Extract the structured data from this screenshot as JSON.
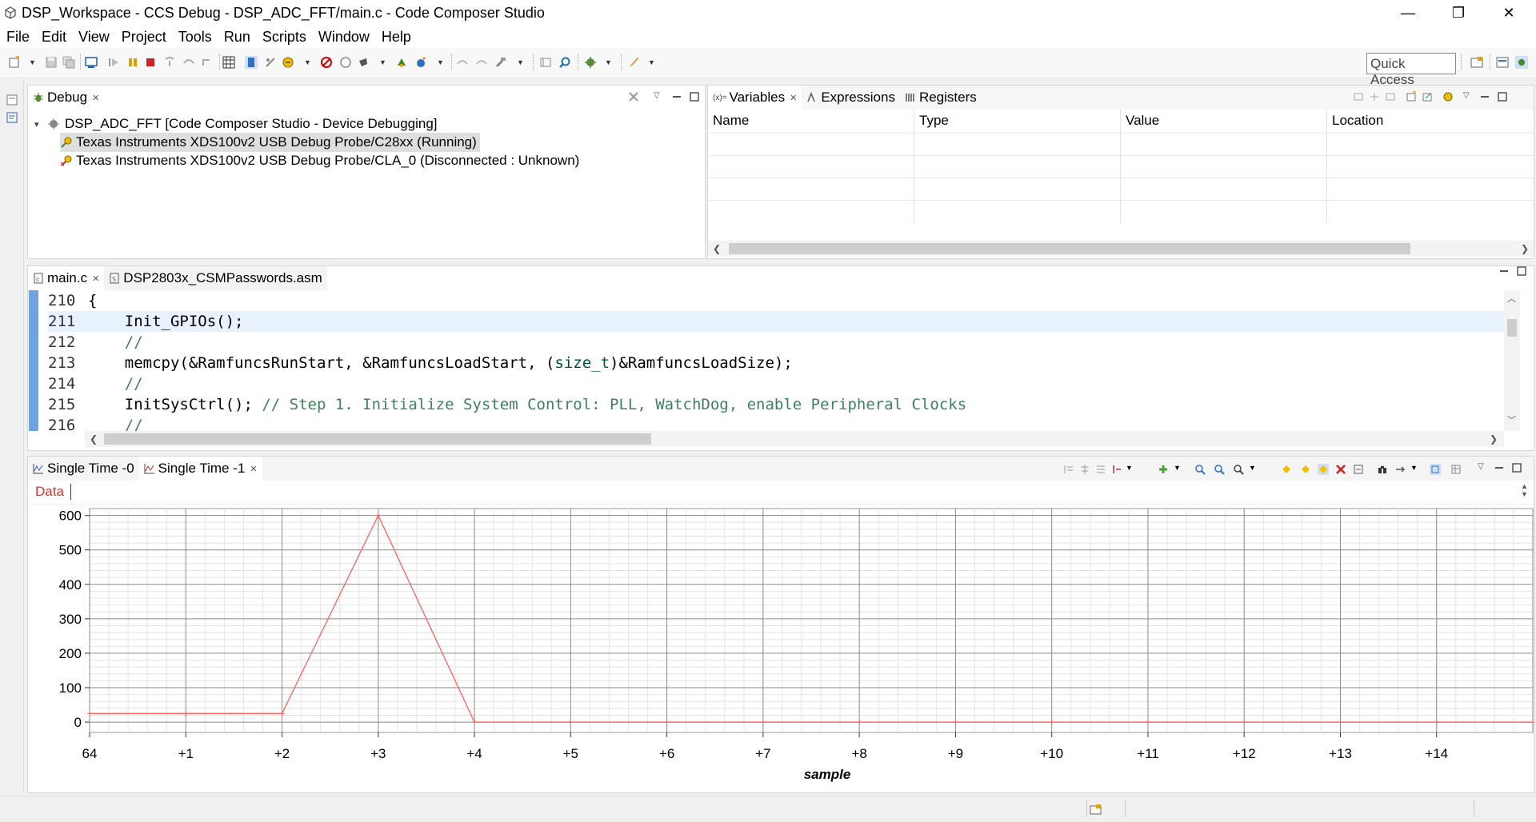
{
  "window": {
    "title": "DSP_Workspace - CCS Debug - DSP_ADC_FFT/main.c - Code Composer Studio",
    "minimize": "—",
    "restore": "❐",
    "close": "✕"
  },
  "menu": [
    "File",
    "Edit",
    "View",
    "Project",
    "Tools",
    "Run",
    "Scripts",
    "Window",
    "Help"
  ],
  "quick_access": "Quick Access",
  "debug_view": {
    "tab_label": "Debug",
    "session": "DSP_ADC_FFT [Code Composer Studio - Device Debugging]",
    "targets": [
      "Texas Instruments XDS100v2 USB Debug Probe/C28xx (Running)",
      "Texas Instruments XDS100v2 USB Debug Probe/CLA_0 (Disconnected : Unknown)"
    ]
  },
  "variables_view": {
    "tabs": [
      "Variables",
      "Expressions",
      "Registers"
    ],
    "tab_prefix": "(x)=",
    "columns": [
      "Name",
      "Type",
      "Value",
      "Location"
    ]
  },
  "editor": {
    "tabs": [
      "main.c",
      "DSP2803x_CSMPasswords.asm"
    ],
    "lines": [
      {
        "num": "210",
        "code": "{",
        "comment": ""
      },
      {
        "num": "211",
        "code": "    Init_GPIOs();",
        "comment": ""
      },
      {
        "num": "212",
        "code": "    //",
        "comment": ""
      },
      {
        "num": "213",
        "code_pre": "    memcpy(&RamfuncsRunStart, &RamfuncsLoadStart, (",
        "code_kw": "size_t",
        "code_post": ")&RamfuncsLoadSize);"
      },
      {
        "num": "214",
        "code": "    //",
        "comment": ""
      },
      {
        "num": "215",
        "code": "    InitSysCtrl(); ",
        "comment": "// Step 1. Initialize System Control: PLL, WatchDog, enable Peripheral Clocks"
      },
      {
        "num": "216",
        "code": "    //",
        "comment": ""
      }
    ]
  },
  "graph_view": {
    "tabs": [
      "Single Time -0",
      "Single Time -1"
    ],
    "legend_label": "Data",
    "colors": {
      "series": "#ff6060",
      "legend": "#e03030"
    }
  },
  "chart_data": {
    "type": "line",
    "x": [
      0,
      1,
      2,
      3,
      4,
      5,
      6,
      7,
      8,
      9,
      10,
      11,
      12,
      13,
      14,
      15
    ],
    "tick_labels": [
      "64",
      "+1",
      "+2",
      "+3",
      "+4",
      "+5",
      "+6",
      "+7",
      "+8",
      "+9",
      "+10",
      "+11",
      "+12",
      "+13",
      "+14"
    ],
    "series": [
      {
        "name": "Data",
        "values": [
          25,
          25,
          25,
          600,
          0,
          0,
          0,
          0,
          0,
          0,
          0,
          0,
          0,
          0,
          0,
          0
        ]
      }
    ],
    "yticks": [
      0,
      100,
      200,
      300,
      400,
      500,
      600
    ],
    "xlabel": "sample",
    "ylabel": "",
    "xlim": [
      0,
      15
    ],
    "ylim": [
      -30,
      620
    ],
    "grid": true
  }
}
